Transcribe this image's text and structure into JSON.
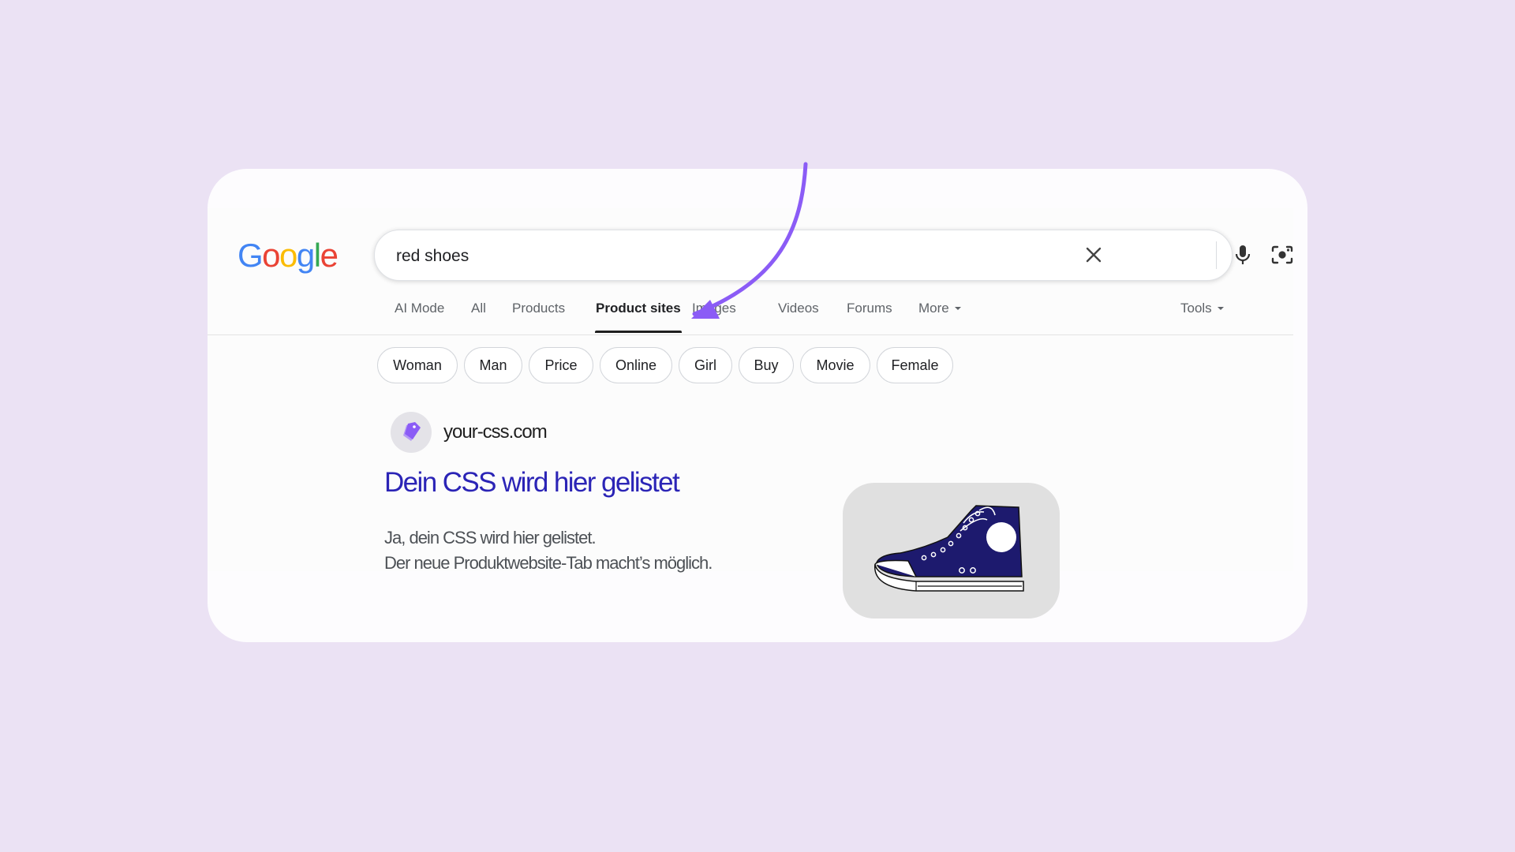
{
  "logo": {
    "text": "Google"
  },
  "search": {
    "query": "red shoes",
    "clear_icon": "close-icon",
    "voice_icon": "microphone-icon",
    "lens_icon": "camera-lens-icon",
    "submit_icon": "search-icon"
  },
  "tabs": [
    {
      "label": "AI Mode",
      "active": false
    },
    {
      "label": "All",
      "active": false
    },
    {
      "label": "Products",
      "active": false
    },
    {
      "label": "Product sites",
      "active": true
    },
    {
      "label": "Images",
      "active": false
    },
    {
      "label": "Videos",
      "active": false
    },
    {
      "label": "Forums",
      "active": false
    },
    {
      "label": "More",
      "active": false
    }
  ],
  "tools_label": "Tools",
  "chips": [
    "Woman",
    "Man",
    "Price",
    "Online",
    "Girl",
    "Buy",
    "Movie",
    "Female"
  ],
  "result": {
    "site_name": "your-css.com",
    "title": "Dein CSS wird hier gelistet",
    "snippet_line1": "Ja, dein CSS wird hier gelistet.",
    "snippet_line2": "Der neue Produktwebsite-Tab macht’s möglich.",
    "favicon_icon": "price-tag-icon",
    "thumbnail": "sneaker-image"
  },
  "colors": {
    "background": "#ebe2f4",
    "arrow": "#8b5cf6",
    "result_title": "#2b24b6",
    "shoe": "#1d1a6e"
  }
}
